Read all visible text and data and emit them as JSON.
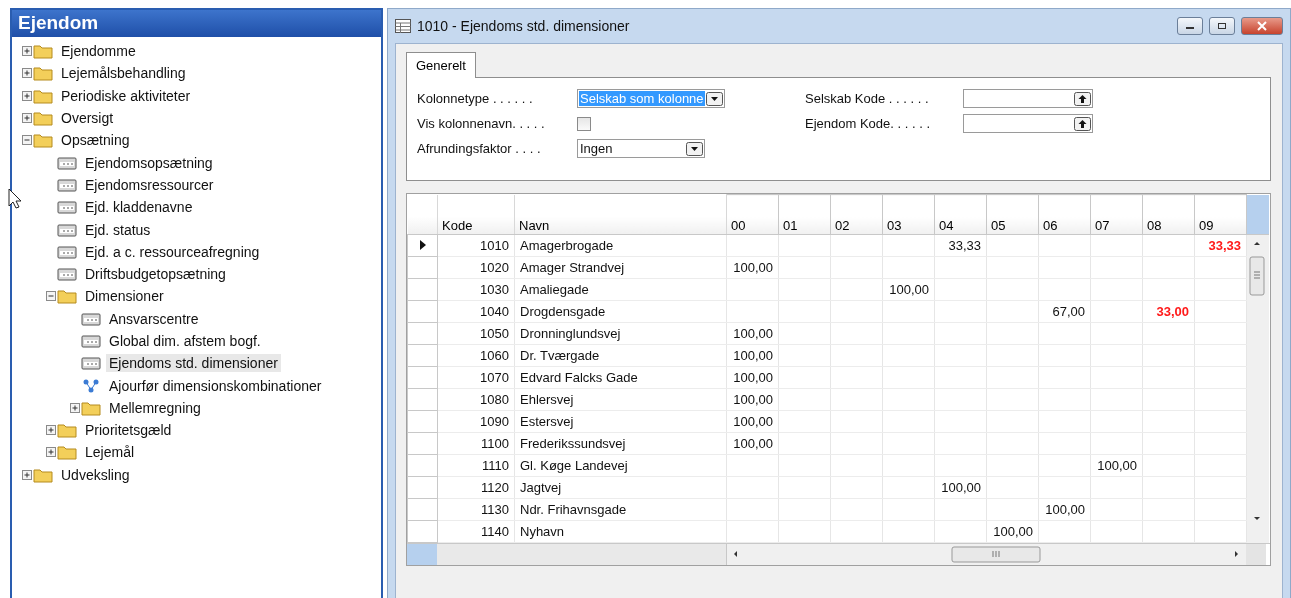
{
  "navigation": {
    "title": "Ejendom",
    "items": [
      {
        "label": "Ejendomme",
        "kind": "folder",
        "expanded": false,
        "selected": false
      },
      {
        "label": "Lejemålsbehandling",
        "kind": "folder",
        "expanded": false,
        "selected": false
      },
      {
        "label": "Periodiske aktiviteter",
        "kind": "folder",
        "expanded": false,
        "selected": false
      },
      {
        "label": "Oversigt",
        "kind": "folder",
        "expanded": false,
        "selected": false
      },
      {
        "label": "Opsætning",
        "kind": "folder",
        "expanded": true,
        "selected": false,
        "children": [
          {
            "label": "Ejendomsopsætning",
            "kind": "form",
            "selected": false
          },
          {
            "label": "Ejendomsressourcer",
            "kind": "form",
            "selected": false
          },
          {
            "label": "Ejd. kladdenavne",
            "kind": "form",
            "selected": false
          },
          {
            "label": "Ejd. status",
            "kind": "form",
            "selected": false
          },
          {
            "label": "Ejd. a c. ressourceafregning",
            "kind": "form",
            "selected": false
          },
          {
            "label": "Driftsbudgetopsætning",
            "kind": "form",
            "selected": false
          },
          {
            "label": "Dimensioner",
            "kind": "folder",
            "expanded": true,
            "selected": false,
            "children": [
              {
                "label": "Ansvarscentre",
                "kind": "form",
                "selected": false
              },
              {
                "label": "Global dim. afstem bogf.",
                "kind": "form",
                "selected": false
              },
              {
                "label": "Ejendoms std. dimensioner",
                "kind": "form",
                "selected": true
              },
              {
                "label": "Ajourfør dimensionskombinationer",
                "kind": "action",
                "selected": false
              },
              {
                "label": "Mellemregning",
                "kind": "folder",
                "expanded": false,
                "selected": false
              }
            ]
          },
          {
            "label": "Prioritetsgæld",
            "kind": "folder",
            "expanded": false,
            "selected": false
          },
          {
            "label": "Lejemål",
            "kind": "folder",
            "expanded": false,
            "selected": false
          }
        ]
      },
      {
        "label": "Udveksling",
        "kind": "folder",
        "expanded": false,
        "selected": false
      }
    ]
  },
  "window": {
    "title": "1010 - Ejendoms std. dimensioner",
    "tabs": [
      {
        "label": "Generelt",
        "selected": true
      }
    ],
    "fields_left": [
      {
        "label": "Kolonnetype . . . . . .",
        "kind": "dropdown",
        "value": "Selskab som kolonne",
        "focused": true
      },
      {
        "label": "Vis kolonnenavn. . . . .",
        "kind": "checkbox",
        "checked": false
      },
      {
        "label": "Afrundingsfaktor . . . .",
        "kind": "dropdown",
        "value": "Ingen",
        "focused": false
      }
    ],
    "fields_right": [
      {
        "label": "Selskab Kode . . . . . .",
        "kind": "lookup"
      },
      {
        "label": "Ejendom Kode. . . . . .",
        "kind": "lookup"
      }
    ],
    "grid": {
      "columns": [
        "Kode",
        "Navn"
      ],
      "period_columns": [
        "00",
        "01",
        "02",
        "03",
        "04",
        "05",
        "06",
        "07",
        "08",
        "09"
      ],
      "rows": [
        {
          "code": "1010",
          "name": "Amagerbrogade",
          "current": true,
          "cells": [
            null,
            null,
            null,
            null,
            {
              "text": "33,33",
              "warning": false
            },
            null,
            null,
            null,
            null,
            {
              "text": "33,33",
              "warning": true
            }
          ]
        },
        {
          "code": "1020",
          "name": "Amager Strandvej",
          "current": false,
          "cells": [
            {
              "text": "100,00",
              "warning": false
            },
            null,
            null,
            null,
            null,
            null,
            null,
            null,
            null,
            null
          ]
        },
        {
          "code": "1030",
          "name": "Amaliegade",
          "current": false,
          "cells": [
            null,
            null,
            null,
            {
              "text": "100,00",
              "warning": false
            },
            null,
            null,
            null,
            null,
            null,
            null
          ]
        },
        {
          "code": "1040",
          "name": "Drogdensgade",
          "current": false,
          "cells": [
            null,
            null,
            null,
            null,
            null,
            null,
            {
              "text": "67,00",
              "warning": false
            },
            null,
            {
              "text": "33,00",
              "warning": true
            },
            null
          ]
        },
        {
          "code": "1050",
          "name": "Dronninglundsvej",
          "current": false,
          "cells": [
            {
              "text": "100,00",
              "warning": false
            },
            null,
            null,
            null,
            null,
            null,
            null,
            null,
            null,
            null
          ]
        },
        {
          "code": "1060",
          "name": "Dr. Tværgade",
          "current": false,
          "cells": [
            {
              "text": "100,00",
              "warning": false
            },
            null,
            null,
            null,
            null,
            null,
            null,
            null,
            null,
            null
          ]
        },
        {
          "code": "1070",
          "name": "Edvard Falcks Gade",
          "current": false,
          "cells": [
            {
              "text": "100,00",
              "warning": false
            },
            null,
            null,
            null,
            null,
            null,
            null,
            null,
            null,
            null
          ]
        },
        {
          "code": "1080",
          "name": "Ehlersvej",
          "current": false,
          "cells": [
            {
              "text": "100,00",
              "warning": false
            },
            null,
            null,
            null,
            null,
            null,
            null,
            null,
            null,
            null
          ]
        },
        {
          "code": "1090",
          "name": "Estersvej",
          "current": false,
          "cells": [
            {
              "text": "100,00",
              "warning": false
            },
            null,
            null,
            null,
            null,
            null,
            null,
            null,
            null,
            null
          ]
        },
        {
          "code": "1100",
          "name": "Frederikssundsvej",
          "current": false,
          "cells": [
            {
              "text": "100,00",
              "warning": false
            },
            null,
            null,
            null,
            null,
            null,
            null,
            null,
            null,
            null
          ]
        },
        {
          "code": "1110",
          "name": "Gl. Køge Landevej",
          "current": false,
          "cells": [
            null,
            null,
            null,
            null,
            null,
            null,
            null,
            {
              "text": "100,00",
              "warning": false
            },
            null,
            null
          ]
        },
        {
          "code": "1120",
          "name": "Jagtvej",
          "current": false,
          "cells": [
            null,
            null,
            null,
            null,
            {
              "text": "100,00",
              "warning": false
            },
            null,
            null,
            null,
            null,
            null
          ]
        },
        {
          "code": "1130",
          "name": "Ndr. Frihavnsgade",
          "current": false,
          "cells": [
            null,
            null,
            null,
            null,
            null,
            null,
            {
              "text": "100,00",
              "warning": false
            },
            null,
            null,
            null
          ]
        },
        {
          "code": "1140",
          "name": "Nyhavn",
          "current": false,
          "cells": [
            null,
            null,
            null,
            null,
            null,
            {
              "text": "100,00",
              "warning": false
            },
            null,
            null,
            null,
            null
          ]
        }
      ]
    }
  }
}
